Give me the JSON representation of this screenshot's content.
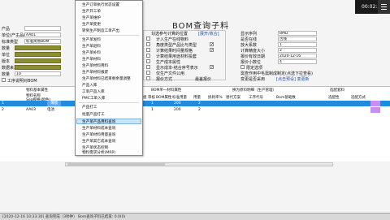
{
  "title": "BOM查询子料",
  "video": {
    "time": "00:02:53"
  },
  "left_form": {
    "row1": {
      "label": "产品",
      "value": ""
    },
    "row2": {
      "label": "单位(产主品编号)",
      "value": "AA01"
    },
    "row3": {
      "label": "标准类型",
      "value": "标准简易BOM"
    },
    "row4": {
      "label": "数量",
      "value": ""
    },
    "row5": {
      "label": "单位",
      "value": ""
    },
    "row6": {
      "label": "版本",
      "value": ""
    },
    "row7": {
      "label": "数据来源",
      "value": ""
    },
    "row8": {
      "label": "数量",
      "value": "10"
    },
    "row9": {
      "label": "工序说明对BOM",
      "value": ""
    }
  },
  "middle_options": {
    "header": "勾选参与计算的位置",
    "header_btn": "[展开/收合]",
    "items": [
      {
        "label": "计入生产在线物料",
        "checked": false
      },
      {
        "label": "角度类型产品比与类型",
        "checked": true
      },
      {
        "label": "计算结果时间量规格",
        "checked": true
      },
      {
        "label": "计算结果用途材料投套",
        "checked": false
      },
      {
        "label": "生产成本属性",
        "checked": false
      },
      {
        "label": "显示成本-结合序号表示",
        "checked": true
      },
      {
        "label": "仅生产文件公用",
        "checked": false
      },
      {
        "label": "报价方式",
        "checked": false
      }
    ],
    "default_label": "最差报价",
    "default_value": ""
  },
  "right_form": {
    "rows": [
      {
        "label": "显示序列",
        "value": "BMD"
      },
      {
        "label": "是否在线",
        "value": "否线"
      },
      {
        "label": "放大系数",
        "value": "1"
      },
      {
        "label": "计算精度大小",
        "value": "2"
      },
      {
        "label": "报价有效日期",
        "value": "2020-12-16"
      },
      {
        "label": "报价小数位",
        "value": "4"
      }
    ],
    "extra_checkbox": "限定选项",
    "note1": "需查作用中毛需制成制定(点选下拉查看)",
    "note2": "变更是否采用",
    "note2_value": "[点击预设] 变更新",
    "btn_query": "查询"
  },
  "grid": {
    "group_headers": [
      "物料基本属性",
      "BOM单一材料属性",
      "换为原料明细（生产管理）",
      "选配套料"
    ],
    "headers": [
      "物料名称",
      "Seq规格(颜色)",
      "单位",
      "组",
      "审核",
      "BOM属性",
      "标准用量",
      "用量",
      "损耗率%",
      "替代方案",
      "工序代号",
      "Bom基础数",
      "选配性",
      "选配方式"
    ],
    "rows": [
      {
        "idx": "1",
        "code": "",
        "name": "薄膜",
        "unit": "小",
        "q1": "1",
        "q2": "200",
        "q3": "2",
        "selected": true
      },
      {
        "idx": "2",
        "code": "AA03",
        "name": "电池",
        "unit": "小",
        "q1": "1",
        "q2": "200",
        "q3": "2",
        "selected": false
      }
    ]
  },
  "context_menu": {
    "items": [
      "生产订单执行状态设置",
      "生产开工单",
      "生产单维护",
      "生产单变更",
      "转到生产制造工单产出",
      "生产单发料",
      "生产单退料",
      "生产单补料",
      "生产单材料",
      "生产单材料用料",
      "生产单材料报废",
      "生产单材料已结束剩余量调整",
      "产品入库",
      "工单产品入库",
      "PMC工单入库",
      "产品打工",
      "批量产品打工",
      "生产单产品用料查询",
      "生产单材料成本查询",
      "生产单材料用量查询",
      "生产单其它成本查询",
      "生产单状态控制",
      "物料需求分析(MRP)"
    ],
    "highlighted_index": 17
  },
  "statusbar": "[2020-12-16 10:23:30] 查询完成（3秒钟）  Bom查询子料已结束: 0.0(0)"
}
